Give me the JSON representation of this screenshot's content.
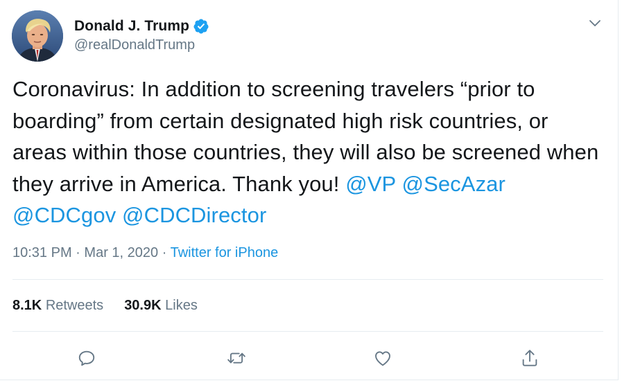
{
  "author": {
    "display_name": "Donald J. Trump",
    "handle": "@realDonaldTrump",
    "verified": true,
    "avatar_icon": "profile-photo"
  },
  "tweet": {
    "text_before": "Coronavirus: In addition to screening travelers “prior to boarding” from certain designated high risk countries, or areas within those countries, they will also be screened when they arrive in America. Thank you! ",
    "mentions": [
      "@VP",
      "@SecAzar",
      "@CDCgov",
      "@CDCDirector"
    ]
  },
  "meta": {
    "time": "10:31 PM",
    "separator": "·",
    "date": "Mar 1, 2020",
    "source": "Twitter for iPhone"
  },
  "stats": {
    "retweets_count": "8.1K",
    "retweets_label": "Retweets",
    "likes_count": "30.9K",
    "likes_label": "Likes"
  },
  "actions": [
    "reply-icon",
    "retweet-icon",
    "like-icon",
    "share-icon"
  ],
  "colors": {
    "link": "#1b95e0",
    "secondary_text": "#657786",
    "primary_text": "#14171a",
    "verified_badge": "#1da1f2",
    "divider": "#e6ecf0"
  }
}
